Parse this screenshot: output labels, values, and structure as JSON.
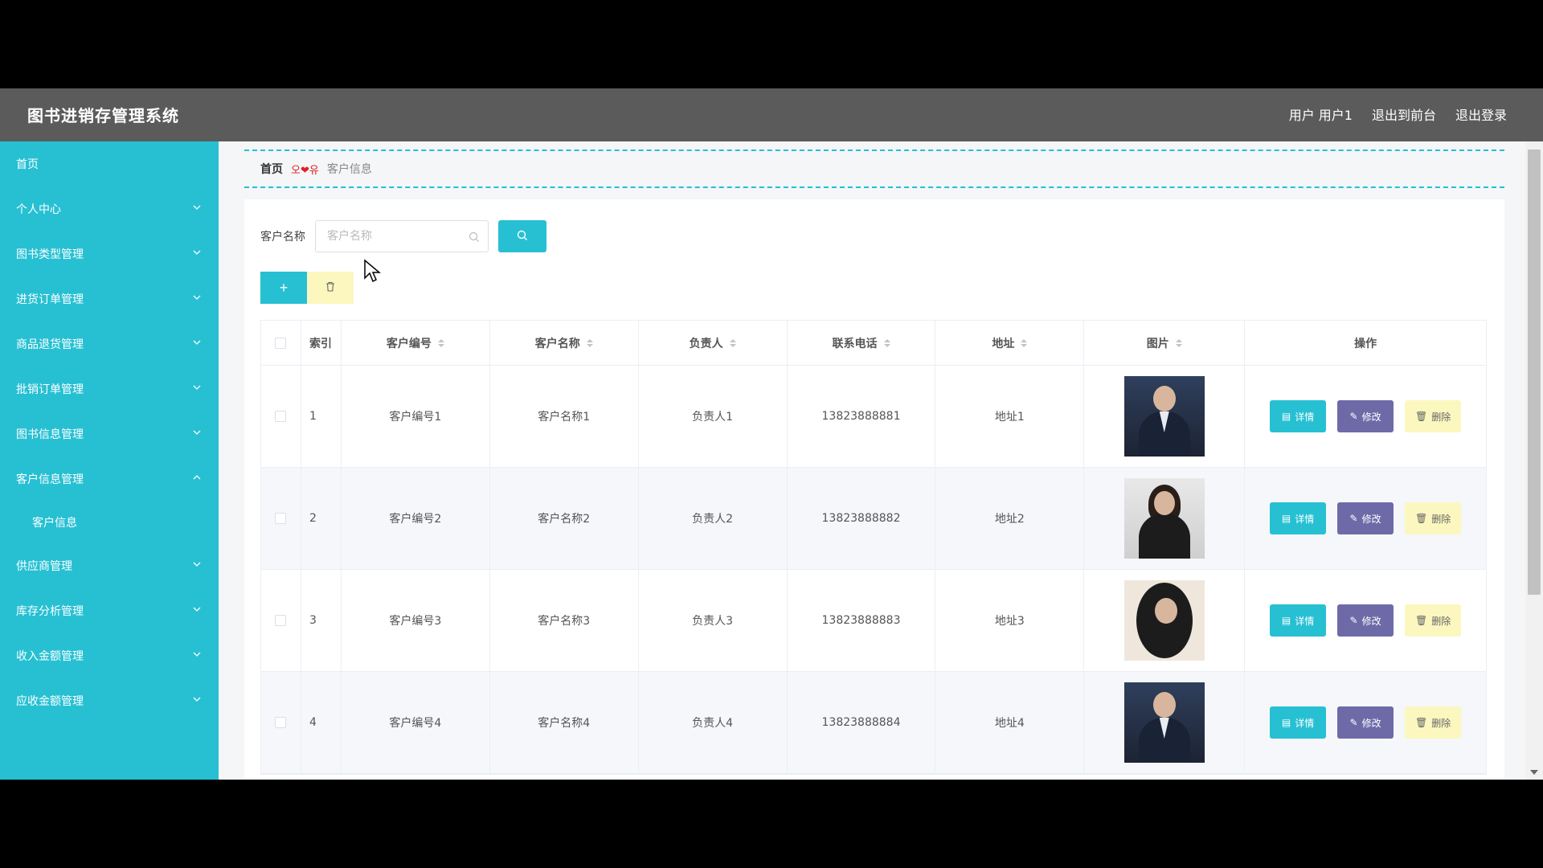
{
  "header": {
    "brand": "图书进销存管理系统",
    "user_label": "用户 用户1",
    "to_front": "退出到前台",
    "logout": "退出登录"
  },
  "sidebar": {
    "items": [
      {
        "label": "首页",
        "has_children": false
      },
      {
        "label": "个人中心",
        "has_children": true
      },
      {
        "label": "图书类型管理",
        "has_children": true
      },
      {
        "label": "进货订单管理",
        "has_children": true
      },
      {
        "label": "商品退货管理",
        "has_children": true
      },
      {
        "label": "批销订单管理",
        "has_children": true
      },
      {
        "label": "图书信息管理",
        "has_children": true
      },
      {
        "label": "客户信息管理",
        "has_children": true,
        "expanded": true
      },
      {
        "label": "供应商管理",
        "has_children": true
      },
      {
        "label": "库存分析管理",
        "has_children": true
      },
      {
        "label": "收入金额管理",
        "has_children": true
      },
      {
        "label": "应收金额管理",
        "has_children": true
      }
    ],
    "sub_items": [
      "客户信息"
    ]
  },
  "breadcrumb": {
    "home": "首页",
    "separator": "오❤유",
    "current": "客户信息"
  },
  "search": {
    "label": "客户名称",
    "placeholder": "客户名称"
  },
  "toolbar": {
    "add_label": "+"
  },
  "table": {
    "headers": [
      "索引",
      "客户编号",
      "客户名称",
      "负责人",
      "联系电话",
      "地址",
      "图片",
      "操作"
    ],
    "rows": [
      {
        "idx": "1",
        "code": "客户编号1",
        "name": "客户名称1",
        "owner": "负责人1",
        "phone": "13823888881",
        "address": "地址1",
        "photo": "male"
      },
      {
        "idx": "2",
        "code": "客户编号2",
        "name": "客户名称2",
        "owner": "负责人2",
        "phone": "13823888882",
        "address": "地址2",
        "photo": "female"
      },
      {
        "idx": "3",
        "code": "客户编号3",
        "name": "客户名称3",
        "owner": "负责人3",
        "phone": "13823888883",
        "address": "地址3",
        "photo": "oval"
      },
      {
        "idx": "4",
        "code": "客户编号4",
        "name": "客户名称4",
        "owner": "负责人4",
        "phone": "13823888884",
        "address": "地址4",
        "photo": "male"
      }
    ],
    "ops": {
      "detail": "详情",
      "edit": "修改",
      "delete": "删除"
    }
  },
  "colors": {
    "accent": "#27c0d3",
    "edit": "#6e6aa8",
    "delete_bg": "#fbf7bf",
    "topbar": "#5b5b5b"
  }
}
